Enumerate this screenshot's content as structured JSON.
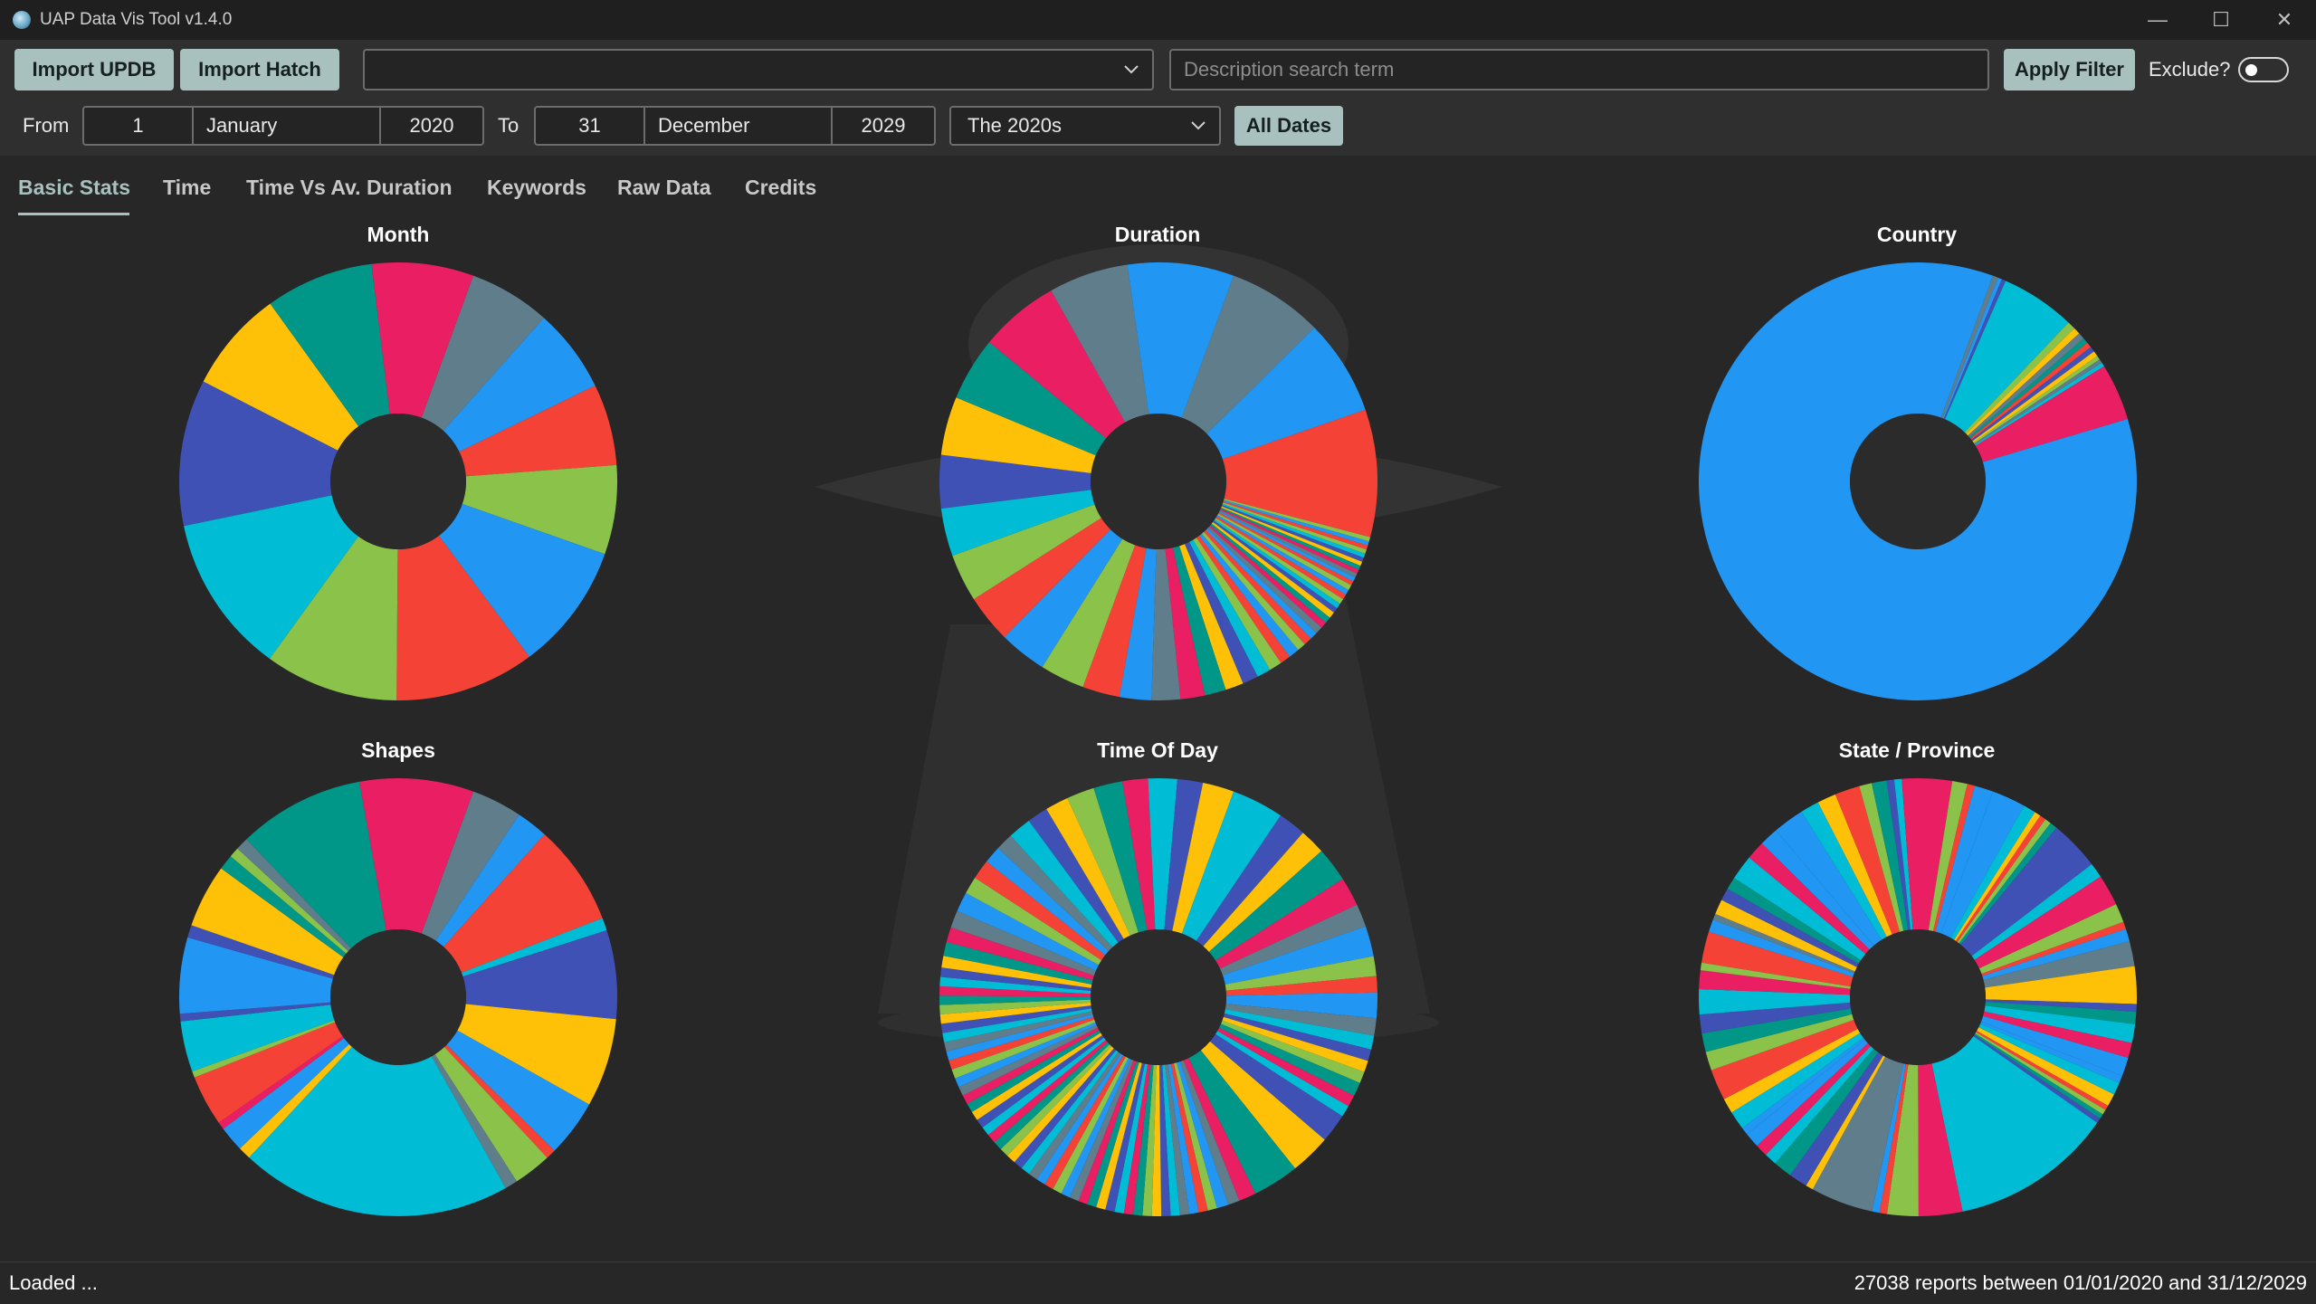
{
  "window": {
    "title": "UAP Data Vis Tool v1.4.0"
  },
  "toolbar": {
    "import_updb": "Import UPDB",
    "import_hatch": "Import Hatch",
    "source_select_value": "",
    "search_placeholder": "Description search term",
    "apply_filter": "Apply Filter",
    "exclude_label": "Exclude?",
    "exclude_checked": false,
    "from_label": "From",
    "from_day": "1",
    "from_month": "January",
    "from_year": "2020",
    "to_label": "To",
    "to_day": "31",
    "to_month": "December",
    "to_year": "2029",
    "decade_value": "The 2020s",
    "all_dates": "All Dates"
  },
  "tabs": [
    "Basic Stats",
    "Time",
    "Time Vs Av. Duration",
    "Keywords",
    "Raw Data",
    "Credits"
  ],
  "active_tab": "Basic Stats",
  "status": {
    "left": "Loaded ...",
    "right": "27038 reports between 01/01/2020 and 31/12/2029"
  },
  "palette": [
    "#5f7d8a",
    "#2196f3",
    "#f44336",
    "#8bc34a",
    "#2196f3",
    "#f44336",
    "#8bc34a",
    "#00bcd4",
    "#3f51b5",
    "#ffc107",
    "#009688",
    "#e91e63"
  ],
  "chart_data": [
    {
      "type": "pie",
      "title": "Month",
      "values": [
        6.4,
        6.6,
        6.4,
        7.0,
        10.0,
        11.0,
        10.5,
        12.5,
        11.5,
        8.0,
        8.5,
        8.0
      ],
      "colors": [
        "#5f7d8a",
        "#2196f3",
        "#f44336",
        "#8bc34a",
        "#2196f3",
        "#f44336",
        "#8bc34a",
        "#00bcd4",
        "#3f51b5",
        "#ffc107",
        "#009688",
        "#e91e63"
      ]
    },
    {
      "type": "pie",
      "title": "Duration",
      "values": [
        9,
        9,
        12,
        0.4,
        0.4,
        0.4,
        0.4,
        0.4,
        0.4,
        0.4,
        0.4,
        0.4,
        0.4,
        0.4,
        0.4,
        0.5,
        0.5,
        0.5,
        0.5,
        0.5,
        0.5,
        0.6,
        0.6,
        0.6,
        0.7,
        0.7,
        0.8,
        0.8,
        1,
        1,
        1.2,
        1.3,
        1.5,
        1.7,
        2,
        2.3,
        2.7,
        3,
        3.5,
        4.2,
        4.5,
        4.5,
        4.5,
        4.5,
        5,
        5.5,
        6,
        7.5,
        7.5,
        10
      ],
      "colors": [
        "#5f7d8a",
        "#2196f3",
        "#f44336",
        "#8bc34a",
        "#2196f3",
        "#f44336",
        "#8bc34a",
        "#00bcd4",
        "#3f51b5",
        "#ffc107",
        "#009688",
        "#e91e63"
      ]
    },
    {
      "type": "pie",
      "title": "Country",
      "values": [
        0.4,
        0.3,
        0.3,
        5.5,
        0.6,
        0.5,
        0.5,
        0.4,
        0.4,
        0.4,
        0.4,
        0.3,
        0.3,
        0.3,
        4.2,
        85
      ],
      "colors": [
        "#5f7d8a",
        "#2196f3",
        "#3f51b5",
        "#00bcd4",
        "#8bc34a",
        "#ffc107",
        "#5f7d8a",
        "#009688",
        "#f44336",
        "#3f51b5",
        "#ffc107",
        "#8bc34a",
        "#5f7d8a",
        "#00bcd4",
        "#e91e63",
        "#2196f3"
      ]
    },
    {
      "type": "pie",
      "title": "Shapes",
      "values": [
        4,
        2.5,
        8,
        1,
        7,
        7,
        4.5,
        0.8,
        3,
        1,
        21.5,
        1,
        2,
        0.6,
        4,
        0.5,
        4,
        0.6,
        6,
        1,
        5,
        1.2,
        0.8,
        1,
        10,
        9
      ],
      "colors": [
        "#5f7d8a",
        "#2196f3",
        "#f44336",
        "#00bcd4",
        "#3f51b5",
        "#ffc107",
        "#2196f3",
        "#f44336",
        "#8bc34a",
        "#5f7d8a",
        "#00bcd4",
        "#ffc107",
        "#2196f3",
        "#e91e63",
        "#f44336",
        "#8bc34a",
        "#00bcd4",
        "#3f51b5",
        "#2196f3",
        "#3f51b5",
        "#ffc107",
        "#009688",
        "#8bc34a",
        "#5f7d8a",
        "#009688",
        "#e91e63"
      ]
    },
    {
      "type": "pie",
      "title": "Time Of Day",
      "values": [
        4.5,
        2.4,
        2.2,
        3,
        2.5,
        2,
        2.6,
        1.7,
        1.4,
        2.2,
        1.5,
        1.2,
        1,
        1,
        1,
        1.2,
        1,
        1,
        2.5,
        3.5,
        4,
        1.5,
        1,
        1,
        0.8,
        0.8,
        0.8,
        0.8,
        0.8,
        0.8,
        0.8,
        0.8,
        0.8,
        0.8,
        0.8,
        0.8,
        0.8,
        0.8,
        0.8,
        0.8,
        0.8,
        0.8,
        0.8,
        0.8,
        0.8,
        0.8,
        0.8,
        0.8,
        0.8,
        0.8,
        0.8,
        0.8,
        0.8,
        0.8,
        0.8,
        0.8,
        0.8,
        0.8,
        0.8,
        0.8,
        0.8,
        0.8,
        0.8,
        0.8,
        0.8,
        0.8,
        0.8,
        0.8,
        0.8,
        0.8,
        1,
        1.2,
        1.3,
        1.5,
        1.7,
        1.5,
        1.7,
        1.5,
        1.5,
        2,
        1.8,
        2,
        2.4,
        2.5,
        2.2,
        2.5,
        2.2,
        2.7
      ],
      "colors": [
        "#00bcd4",
        "#3f51b5",
        "#ffc107",
        "#009688",
        "#e91e63",
        "#5f7d8a",
        "#2196f3",
        "#8bc34a",
        "#f44336",
        "#2196f3",
        "#5f7d8a",
        "#00bcd4",
        "#3f51b5",
        "#ffc107",
        "#8bc34a",
        "#009688",
        "#e91e63"
      ]
    },
    {
      "type": "pie",
      "title": "State / Province",
      "values": [
        2.7,
        1,
        0.5,
        0.5,
        0.5,
        0.6,
        4,
        1.2,
        2.5,
        1.5,
        0.6,
        1,
        2,
        3,
        0.6,
        1,
        1.5,
        1.2,
        1.5,
        0.6,
        1,
        1,
        0.4,
        0.4,
        0.4,
        0.4,
        13,
        3.5,
        2.5,
        0.6,
        0.6,
        5,
        0.6,
        1.5,
        1.5,
        1,
        1,
        1.2,
        0.6,
        1.5,
        1.2,
        2.5,
        1.5,
        1.5,
        1.5,
        2,
        1.5,
        0.6,
        2.5,
        1,
        0.5,
        1.2,
        1,
        1,
        2,
        1.5,
        1.5,
        2.5,
        1.5,
        1.5,
        2,
        1,
        1.2,
        0.6,
        0.6,
        4,
        1.2,
        0.6,
        1.5
      ],
      "colors": [
        "#2196f3",
        "#00bcd4",
        "#ffc107",
        "#f44336",
        "#8bc34a",
        "#009688",
        "#3f51b5",
        "#00bcd4",
        "#e91e63",
        "#8bc34a",
        "#f44336",
        "#2196f3",
        "#5f7d8a",
        "#ffc107",
        "#3f51b5",
        "#009688",
        "#00bcd4",
        "#e91e63",
        "#2196f3"
      ]
    }
  ]
}
